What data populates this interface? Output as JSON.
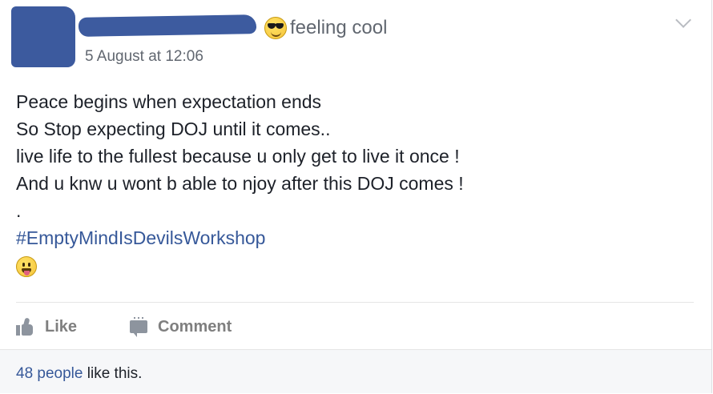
{
  "post": {
    "feeling_text": "feeling cool",
    "feeling_icon": "sunglasses-emoji-icon",
    "timestamp": "5 August at 12:06",
    "lines": [
      "Peace begins when expectation ends",
      "So Stop expecting DOJ until it comes..",
      "live life to the fullest because u only get to live it once !",
      "And u knw u wont b able to njoy after this DOJ comes !",
      "."
    ],
    "hashtag": "#EmptyMindIsDevilsWorkshop",
    "trailing_emoji": "tongue-out-emoji-icon"
  },
  "actions": {
    "like_label": "Like",
    "comment_label": "Comment"
  },
  "footer": {
    "likes_count_link": "48 people",
    "likes_suffix": " like this."
  },
  "colors": {
    "link": "#365899",
    "redaction": "#3d5b9f",
    "muted": "#616770",
    "action_gray": "#7f7f7f",
    "footer_bg": "#f6f7f9"
  }
}
